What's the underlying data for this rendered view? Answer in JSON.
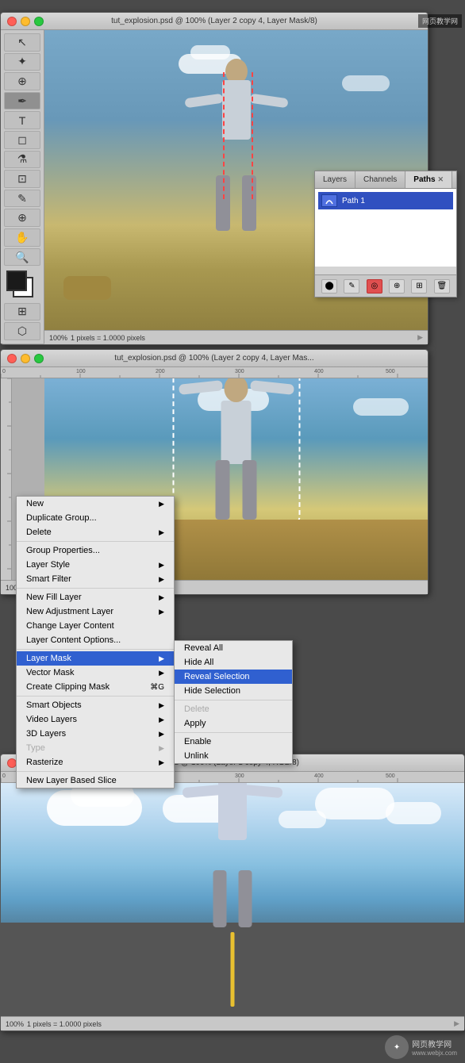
{
  "window1": {
    "title": "tut_explosion.psd @ 100% (Layer 2 copy 4, Layer Mask/8)",
    "zoom": "100%",
    "pixel_info": "1 pixels = 1.0000 pixels"
  },
  "window2": {
    "title": "tut_explosion.psd @ 100% (Layer 2 copy 4, Layer Mas..."
  },
  "window3": {
    "title": "psd @ 100% (Layer 1 copy 4, RGB/8)",
    "zoom": "100%",
    "pixel_info": "1 pixels = 1.0000 pixels"
  },
  "paths_panel": {
    "tabs": [
      "Layers",
      "Channels",
      "Paths"
    ],
    "active_tab": "Paths",
    "path_item": "Path 1"
  },
  "context_menu": {
    "items": [
      {
        "label": "New",
        "has_arrow": true,
        "disabled": false
      },
      {
        "label": "Duplicate Group...",
        "has_arrow": false,
        "disabled": false
      },
      {
        "label": "Delete",
        "has_arrow": true,
        "disabled": false
      },
      {
        "label": "",
        "separator": true
      },
      {
        "label": "Group Properties...",
        "has_arrow": false,
        "disabled": false
      },
      {
        "label": "Layer Style",
        "has_arrow": true,
        "disabled": false
      },
      {
        "label": "Smart Filter",
        "has_arrow": true,
        "disabled": false
      },
      {
        "label": "",
        "separator": true
      },
      {
        "label": "New Fill Layer",
        "has_arrow": true,
        "disabled": false
      },
      {
        "label": "New Adjustment Layer",
        "has_arrow": true,
        "disabled": false
      },
      {
        "label": "Change Layer Content",
        "has_arrow": false,
        "disabled": false
      },
      {
        "label": "Layer Content Options...",
        "has_arrow": false,
        "disabled": false
      },
      {
        "label": "",
        "separator": true
      },
      {
        "label": "Layer Mask",
        "has_arrow": true,
        "disabled": false,
        "active": true
      },
      {
        "label": "Vector Mask",
        "has_arrow": true,
        "disabled": false
      },
      {
        "label": "Create Clipping Mask",
        "has_arrow": false,
        "shortcut": "⌘G",
        "disabled": false
      },
      {
        "label": "",
        "separator": true
      },
      {
        "label": "Smart Objects",
        "has_arrow": true,
        "disabled": false
      },
      {
        "label": "Video Layers",
        "has_arrow": true,
        "disabled": false
      },
      {
        "label": "3D Layers",
        "has_arrow": true,
        "disabled": false
      },
      {
        "label": "Type",
        "has_arrow": true,
        "disabled": true
      },
      {
        "label": "Rasterize",
        "has_arrow": true,
        "disabled": false
      },
      {
        "label": "",
        "separator": true
      },
      {
        "label": "New Layer Based Slice",
        "has_arrow": false,
        "disabled": false
      }
    ]
  },
  "submenu": {
    "items": [
      {
        "label": "Reveal All",
        "disabled": false
      },
      {
        "label": "Hide All",
        "disabled": false
      },
      {
        "label": "Reveal Selection",
        "disabled": false,
        "active": true
      },
      {
        "label": "Hide Selection",
        "disabled": false
      },
      {
        "label": "",
        "separator": true
      },
      {
        "label": "Delete",
        "disabled": true
      },
      {
        "label": "Apply",
        "disabled": false
      },
      {
        "label": "",
        "separator": true
      },
      {
        "label": "Enable",
        "disabled": false
      },
      {
        "label": "Unlink",
        "disabled": false
      }
    ]
  },
  "watermark": {
    "text": "网页教学网",
    "subtext": "www.webjx.com"
  },
  "toolbar": {
    "tools": [
      "↖",
      "✦",
      "⊕",
      "✒",
      "T",
      "⬣",
      "◎",
      "✂",
      "⊡",
      "✋",
      "🔍",
      "⬛"
    ]
  }
}
